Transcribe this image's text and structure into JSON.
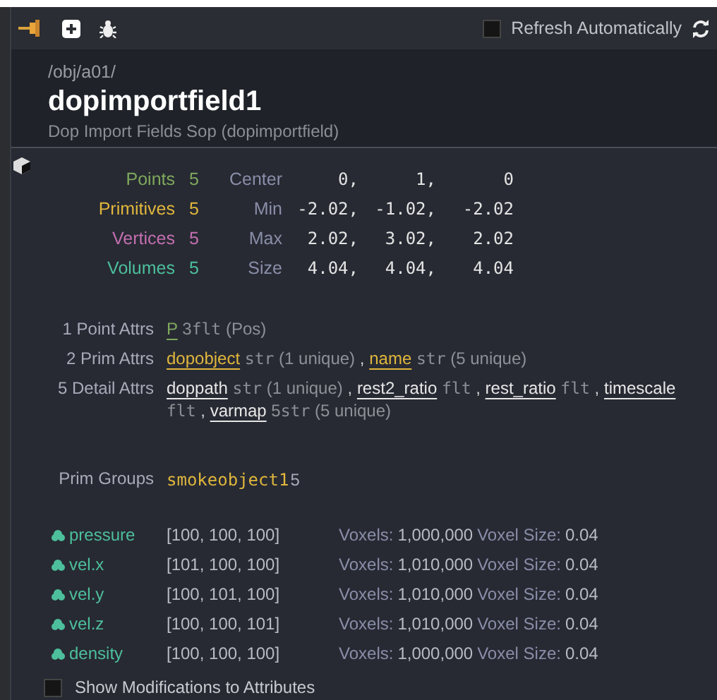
{
  "toolbar": {
    "refresh_automatically": {
      "label": "Refresh Automatically",
      "checked": false
    }
  },
  "header": {
    "path": "/obj/a01/",
    "name": "dopimportfield1",
    "type": "Dop Import Fields Sop (dopimportfield)"
  },
  "counts": [
    {
      "label": "Points",
      "value": "5",
      "color": "#7fa85c"
    },
    {
      "label": "Primitives",
      "value": "5",
      "color": "#e0b63c"
    },
    {
      "label": "Vertices",
      "value": "5",
      "color": "#c46fb0"
    },
    {
      "label": "Volumes",
      "value": "5",
      "color": "#4dbf9c"
    }
  ],
  "bounds": [
    {
      "label": "Center",
      "values": [
        "0,",
        "1,",
        "0"
      ]
    },
    {
      "label": "Min",
      "values": [
        "-2.02,",
        "-1.02,",
        "-2.02"
      ]
    },
    {
      "label": "Max",
      "values": [
        "2.02,",
        "3.02,",
        "2.02"
      ]
    },
    {
      "label": "Size",
      "values": [
        "4.04,",
        "4.04,",
        "4.04"
      ]
    }
  ],
  "attributes": [
    {
      "label": "1 Point Attrs",
      "items": [
        {
          "name": "P",
          "color": "#7fa85c",
          "count": "3",
          "type": "flt",
          "note": "(Pos)"
        }
      ]
    },
    {
      "label": "2 Prim Attrs",
      "items": [
        {
          "name": "dopobject",
          "color": "#e0b63c",
          "type": "str",
          "note": "(1 unique)",
          "suffix": ","
        },
        {
          "name": "name",
          "color": "#e0b63c",
          "type": "str",
          "note": "(5 unique)"
        }
      ]
    },
    {
      "label": "5 Detail Attrs",
      "items": [
        {
          "name": "doppath",
          "color": "#e6e6e6",
          "type": "str",
          "note": "(1 unique)",
          "suffix": ","
        },
        {
          "name": "rest2_ratio",
          "color": "#e6e6e6",
          "type": "flt",
          "suffix": ","
        },
        {
          "name": "rest_ratio",
          "color": "#e6e6e6",
          "type": "flt",
          "suffix": ","
        },
        {
          "name": "timescale",
          "color": "#e6e6e6",
          "type": "flt",
          "suffix": ","
        },
        {
          "name": "varmap",
          "color": "#e6e6e6",
          "count": "5",
          "type": "str",
          "note": "(5 unique)"
        }
      ]
    }
  ],
  "prim_groups": {
    "label": "Prim Groups",
    "items": [
      {
        "name": "smokeobject1",
        "count": "5"
      }
    ]
  },
  "volumes": [
    {
      "name": "pressure",
      "resolution": "[100, 100, 100]",
      "voxels_label": "Voxels:",
      "voxels": "1,000,000",
      "size_label": "Voxel Size:",
      "size": "0.04"
    },
    {
      "name": "vel.x",
      "resolution": "[101, 100, 100]",
      "voxels_label": "Voxels:",
      "voxels": "1,010,000",
      "size_label": "Voxel Size:",
      "size": "0.04"
    },
    {
      "name": "vel.y",
      "resolution": "[100, 101, 100]",
      "voxels_label": "Voxels:",
      "voxels": "1,010,000",
      "size_label": "Voxel Size:",
      "size": "0.04"
    },
    {
      "name": "vel.z",
      "resolution": "[100, 100, 101]",
      "voxels_label": "Voxels:",
      "voxels": "1,010,000",
      "size_label": "Voxel Size:",
      "size": "0.04"
    },
    {
      "name": "density",
      "resolution": "[100, 100, 100]",
      "voxels_label": "Voxels:",
      "voxels": "1,000,000",
      "size_label": "Voxel Size:",
      "size": "0.04"
    }
  ],
  "show_modifications": {
    "label": "Show Modifications to Attributes",
    "checked": false
  }
}
